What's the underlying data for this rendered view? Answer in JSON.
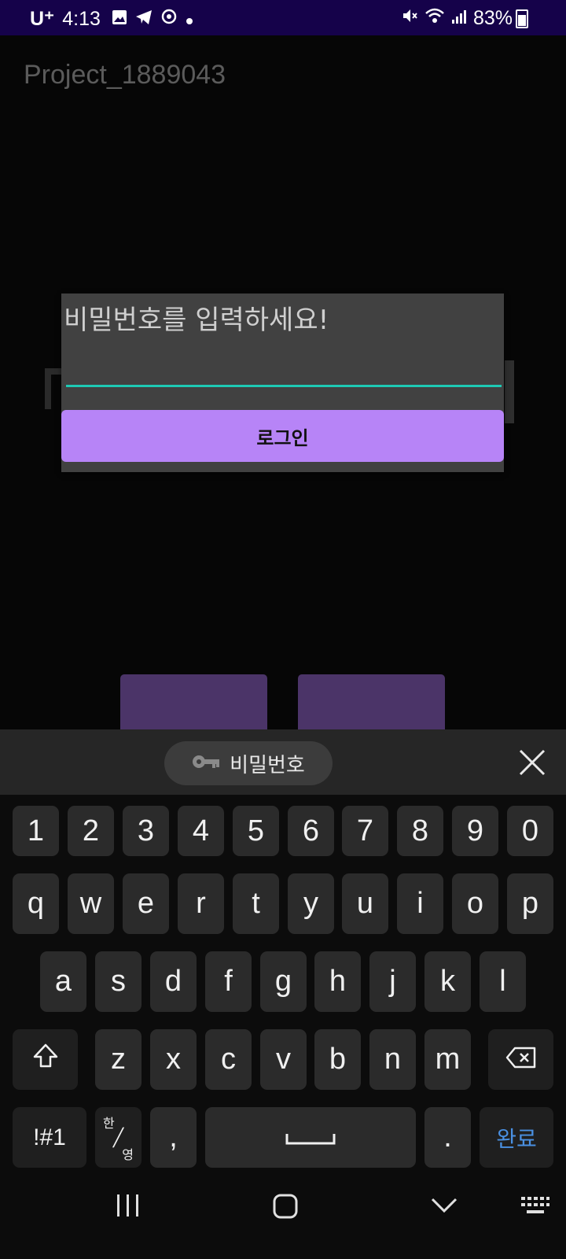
{
  "status_bar": {
    "carrier": "U⁺",
    "time": "4:13",
    "battery": "83%"
  },
  "app": {
    "title": "Project_1889043"
  },
  "dialog": {
    "prompt": "비밀번호를 입력하세요!",
    "input_value": "",
    "login_button": "로그인"
  },
  "keyboard": {
    "suggestion_chip": "비밀번호",
    "number_row": [
      "1",
      "2",
      "3",
      "4",
      "5",
      "6",
      "7",
      "8",
      "9",
      "0"
    ],
    "row1": [
      "q",
      "w",
      "e",
      "r",
      "t",
      "y",
      "u",
      "i",
      "o",
      "p"
    ],
    "row2": [
      "a",
      "s",
      "d",
      "f",
      "g",
      "h",
      "j",
      "k",
      "l"
    ],
    "row3": [
      "z",
      "x",
      "c",
      "v",
      "b",
      "n",
      "m"
    ],
    "symbols_key": "!#1",
    "lang_top": "한",
    "lang_bottom": "영",
    "comma": ",",
    "period": ".",
    "done_key": "완료"
  },
  "colors": {
    "status_bar_bg": "#15024a",
    "login_button_bg": "#b784f7",
    "input_underline": "#1ec9b4",
    "done_key_text": "#4a90e2"
  }
}
